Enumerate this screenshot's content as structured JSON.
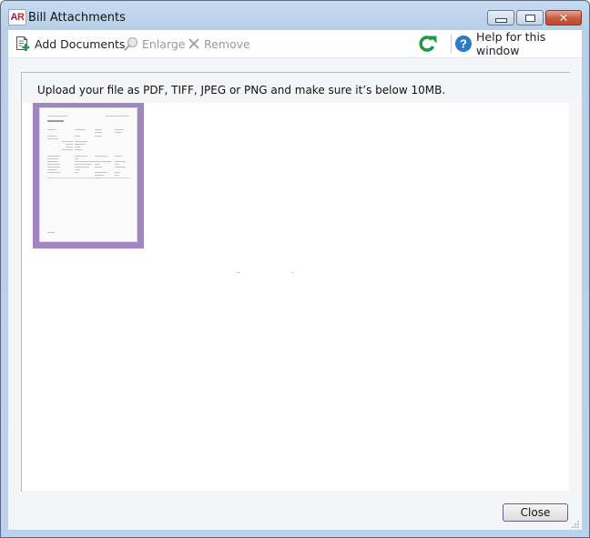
{
  "window": {
    "title": "Bill Attachments",
    "logo_text_a": "A",
    "logo_text_r": "R"
  },
  "toolbar": {
    "add_documents_label": "Add Documents",
    "enlarge_label": "Enlarge",
    "remove_label": "Remove",
    "help_label": "Help for this window"
  },
  "main": {
    "instruction": "Upload your file as PDF, TIFF, JPEG or PNG and make sure it’s below 10MB.",
    "attachments": [
      {
        "type": "document-thumbnail",
        "selected": true
      }
    ]
  },
  "footer": {
    "close_label": "Close"
  },
  "colors": {
    "selection": "#a185c0",
    "refresh_green": "#1f9a48",
    "help_blue": "#2a7cc7"
  }
}
